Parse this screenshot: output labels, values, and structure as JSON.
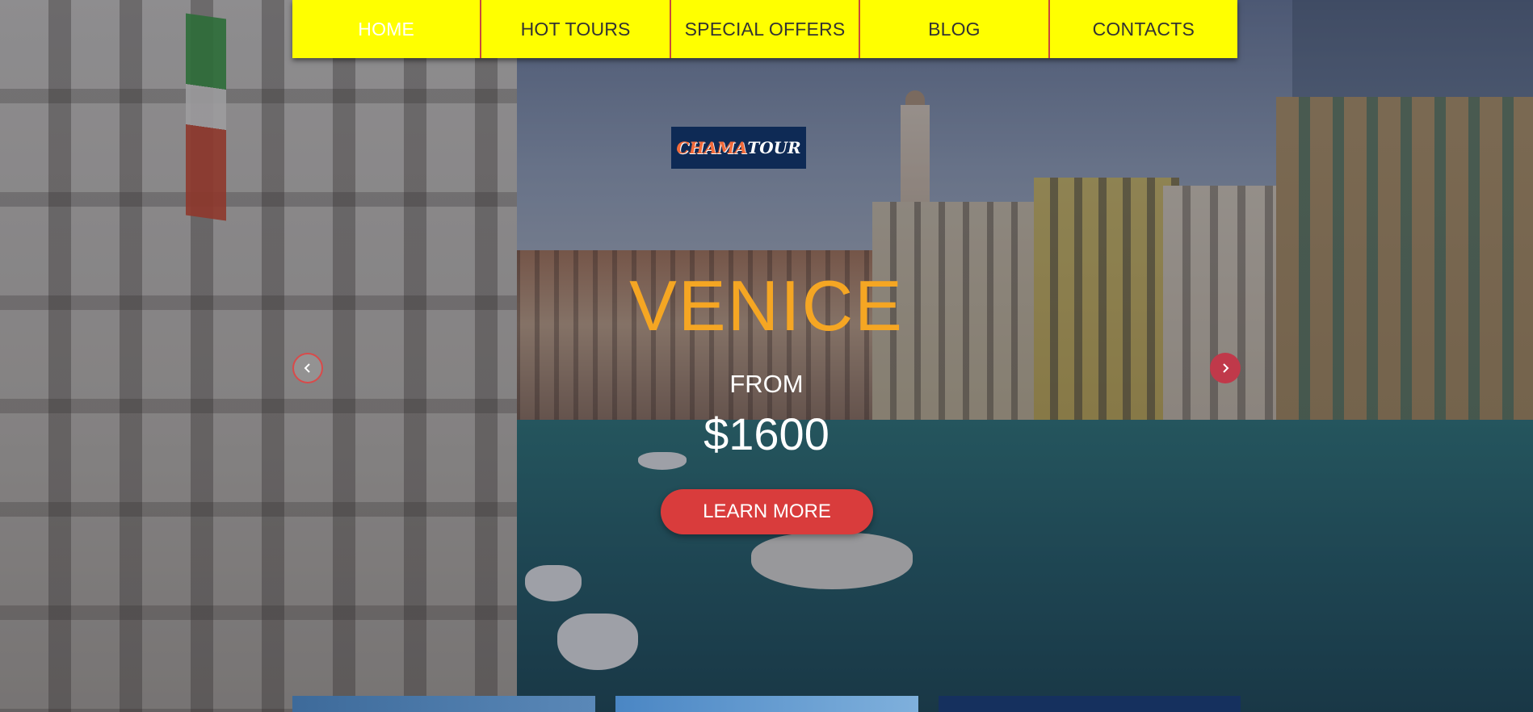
{
  "nav": {
    "items": [
      {
        "label": "HOME",
        "active": true
      },
      {
        "label": "HOT TOURS",
        "active": false
      },
      {
        "label": "SPECIAL OFFERS",
        "active": false
      },
      {
        "label": "BLOG",
        "active": false
      },
      {
        "label": "CONTACTS",
        "active": false
      }
    ]
  },
  "logo": {
    "part1": "CHAMA",
    "part2": "TOUR"
  },
  "hero": {
    "title": "VENICE",
    "from_label": "FROM",
    "price": "$1600",
    "cta_label": "LEARN MORE"
  },
  "slider": {
    "prev_icon": "chevron-left-icon",
    "next_icon": "chevron-right-icon"
  },
  "colors": {
    "nav_background": "#ffff00",
    "nav_divider": "#c94a3b",
    "title": "#f5a623",
    "cta_background": "#d93c3c",
    "logo_background": "#0e2a55"
  }
}
